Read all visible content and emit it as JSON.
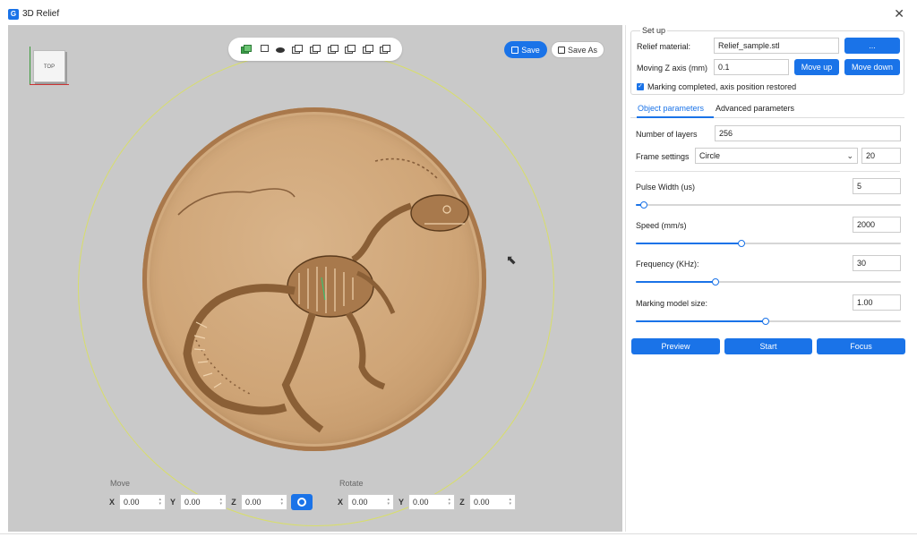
{
  "window": {
    "title": "3D Relief",
    "app_icon": "G",
    "close_label": "✕"
  },
  "viewport": {
    "view_cube_label": "TOP",
    "toolbar_icons": [
      "solid-cube-icon",
      "wireframe-cube-icon",
      "eye-icon",
      "front-view-icon",
      "back-view-icon",
      "left-view-icon",
      "right-view-icon",
      "top-view-icon",
      "bottom-view-icon"
    ],
    "save_label": "Save",
    "save_as_label": "Save As",
    "move": {
      "title": "Move",
      "x_label": "X",
      "x_value": "0.00",
      "y_label": "Y",
      "y_value": "0.00",
      "z_label": "Z",
      "z_value": "0.00"
    },
    "rotate": {
      "title": "Rotate",
      "x_label": "X",
      "x_value": "0.00",
      "y_label": "Y",
      "y_value": "0.00",
      "z_label": "Z",
      "z_value": "0.00"
    },
    "colors": {
      "background": "#c9c9c9",
      "coin": "#cfa577",
      "ring": "#d8de6a"
    }
  },
  "setup": {
    "legend": "Set up",
    "relief_material_label": "Relief material:",
    "relief_material_value": "Relief_sample.stl",
    "browse_label": "...",
    "moving_z_label": "Moving Z axis (mm)",
    "moving_z_value": "0.1",
    "move_up_label": "Move up",
    "move_down_label": "Move down",
    "checkbox_label": "Marking completed, axis position restored",
    "checkbox_checked": true
  },
  "tabs": {
    "object_params": "Object parameters",
    "advanced_params": "Advanced parameters",
    "active": "object_params"
  },
  "params": {
    "layers_label": "Number of layers",
    "layers_value": "256",
    "frame_label": "Frame settings",
    "frame_select": "Circle",
    "frame_value": "20",
    "pulse_label": "Pulse Width (us)",
    "pulse_value": "5",
    "speed_label": "Speed (mm/s)",
    "speed_value": "2000",
    "frequency_label": "Frequency (KHz):",
    "frequency_value": "30",
    "model_size_label": "Marking model size:",
    "model_size_value": "1.00"
  },
  "sliders": {
    "pulse": 0.03,
    "speed": 0.4,
    "frequency": 0.3,
    "model_size": 0.49
  },
  "actions": {
    "preview": "Preview",
    "start": "Start",
    "focus": "Focus"
  },
  "accent_color": "#1a73e8"
}
